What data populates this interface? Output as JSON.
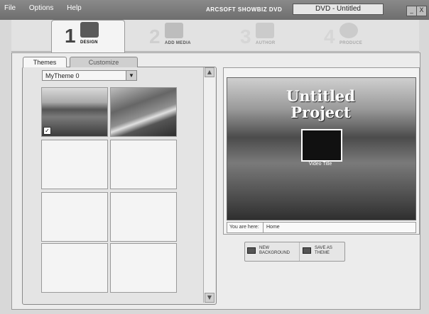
{
  "menu": {
    "items": [
      "File",
      "Options",
      "Help"
    ]
  },
  "app": {
    "name": "ARCSOFT SHOWBIZ DVD",
    "document_title": "DVD - Untitled"
  },
  "window": {
    "minimize": "_",
    "close": "X"
  },
  "steps": [
    {
      "number": "1",
      "label": "DESIGN",
      "icon": "design-icon",
      "active": true
    },
    {
      "number": "2",
      "label": "ADD MEDIA",
      "icon": "add-media-icon",
      "active": false
    },
    {
      "number": "3",
      "label": "AUTHOR",
      "icon": "author-icon",
      "active": false
    },
    {
      "number": "4",
      "label": "PRODUCE",
      "icon": "produce-icon",
      "active": false
    }
  ],
  "tabs": {
    "themes": "Themes",
    "customize": "Customize"
  },
  "theme_select": {
    "value": "MyTheme 0"
  },
  "preview": {
    "title_line1": "Untitled",
    "title_line2": "Project",
    "video_title": "Video Title",
    "you_are_here_label": "You are here:",
    "location": "Home"
  },
  "actions": {
    "new_background": "NEW BACKGROUND",
    "save_as_theme": "SAVE AS THEME"
  }
}
